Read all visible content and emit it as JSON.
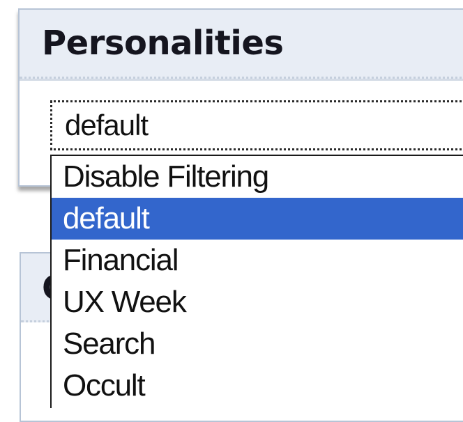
{
  "panels": {
    "personalities": {
      "title": "Personalities"
    },
    "second": {
      "title": "C"
    }
  },
  "select": {
    "value": "default",
    "options": [
      {
        "label": "Disable Filtering",
        "selected": false
      },
      {
        "label": "default",
        "selected": true
      },
      {
        "label": "Financial",
        "selected": false
      },
      {
        "label": "UX Week",
        "selected": false
      },
      {
        "label": "Search",
        "selected": false
      },
      {
        "label": "Occult",
        "selected": false
      }
    ]
  },
  "colors": {
    "highlight": "#3366cc",
    "header_bg": "#e8edf5",
    "border": "#b7c4d6"
  }
}
